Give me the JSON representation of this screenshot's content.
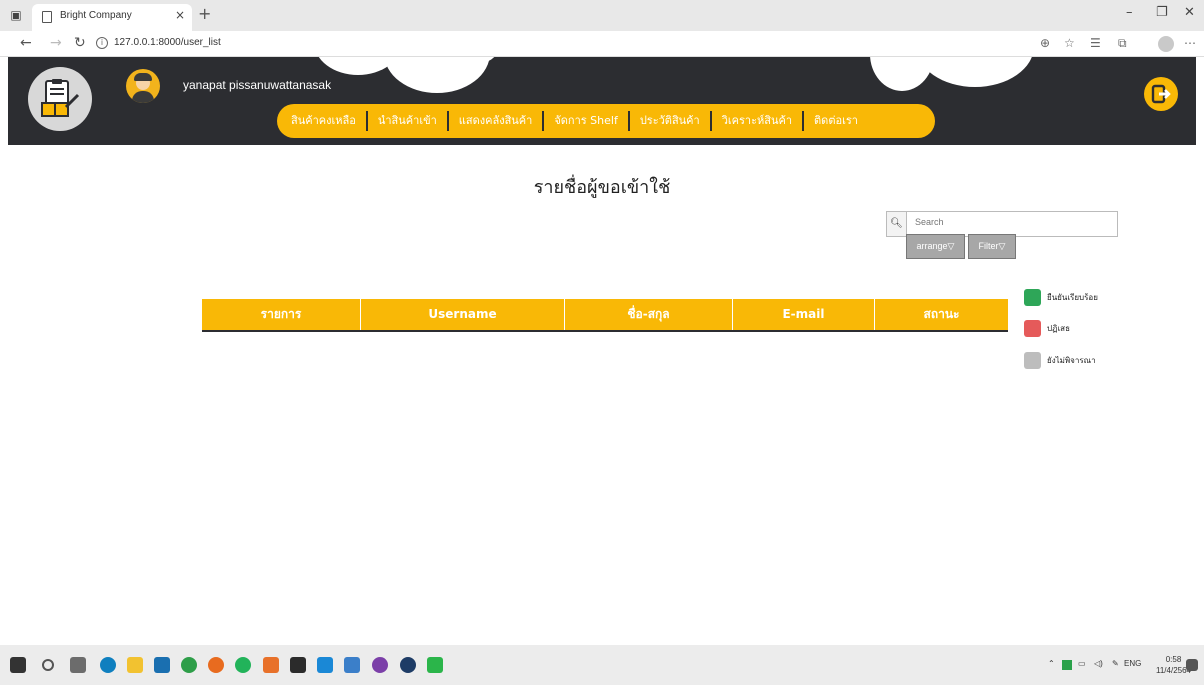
{
  "browser": {
    "tab_title": "Bright Company",
    "tab_close": "×",
    "new_tab": "+",
    "url": "127.0.0.1:8000/user_list",
    "minimize": "–",
    "restore": "❐",
    "close": "✕"
  },
  "header": {
    "username": "yanapat pissanuwattanasak",
    "menu": [
      "สินค้าคงเหลือ",
      "นำสินค้าเข้า",
      "แสดงคลังสินค้า",
      "จัดการ Shelf",
      "ประวัติสินค้า",
      "วิเคราะห์สินค้า",
      "ติดต่อเรา"
    ],
    "colors": {
      "header_bg": "#2c2d31",
      "menu_bg": "#f9b806"
    }
  },
  "main": {
    "title": "รายชื่อผู้ขอเข้าใช้",
    "search_placeholder": "Search",
    "arrange_label": "arrange▽",
    "filter_label": "Filter▽",
    "table_headers": [
      "รายการ",
      "Username",
      "ชื่อ-สกุล",
      "E-mail",
      "สถานะ"
    ],
    "legend": [
      {
        "label": "ยืนยันเรียบร้อย",
        "color": "#2ea658"
      },
      {
        "label": "ปฏิเสธ",
        "color": "#e55a5a"
      },
      {
        "label": "ยังไม่พิจารณา",
        "color": "#bdbdbd"
      }
    ]
  },
  "taskbar": {
    "tray_lang": "ENG",
    "time": "0:58",
    "date": "11/4/2564"
  }
}
